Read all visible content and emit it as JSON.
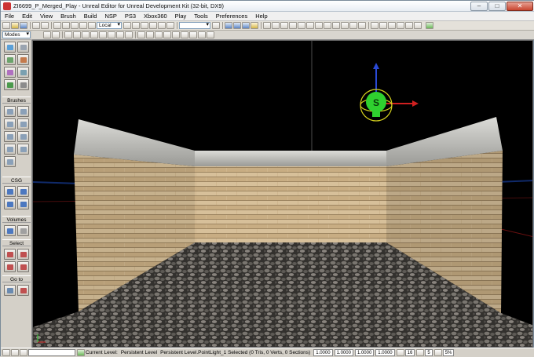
{
  "window": {
    "title": "ZI6699_P_Merged_Play - Unreal Editor for Unreal Development Kit (32-bit, DX9)",
    "min_label": "–",
    "max_label": "□",
    "close_label": "✕"
  },
  "menu": [
    {
      "label": "File"
    },
    {
      "label": "Edit"
    },
    {
      "label": "View"
    },
    {
      "label": "Brush"
    },
    {
      "label": "Build"
    },
    {
      "label": "NSP"
    },
    {
      "label": "PS3"
    },
    {
      "label": "Xbox360"
    },
    {
      "label": "Play"
    },
    {
      "label": "Tools"
    },
    {
      "label": "Preferences"
    },
    {
      "label": "Help"
    }
  ],
  "toolbar": {
    "coord_system": "Local"
  },
  "mode_selector": {
    "label": "Modes"
  },
  "sidebar": {
    "sections": [
      {
        "label": "Brushes"
      },
      {
        "label": "CSG"
      },
      {
        "label": "Volumes"
      },
      {
        "label": "Select"
      },
      {
        "label": "Go to"
      }
    ]
  },
  "viewport": {
    "gizmo_icon": "light-gizmo-icon",
    "gizmo_label": "S"
  },
  "statusbar": {
    "current_level_label": "Current Level:",
    "current_level_value": "Persistent Level",
    "selection_text": "Persistent Level.PointLight_1 Selected (0 Tris, 0 Verts, 0 Sections)",
    "scale_x": "1.0000",
    "scale_y": "1.0000",
    "scale_z": "1.0000",
    "scale_w": "1.0000",
    "grid_size": "16",
    "rot_snap": "5",
    "scale_snap": "5%"
  },
  "colors": {
    "titlebar": "#e8edf3",
    "viewport_bg": "#000000",
    "gizmo_green": "#2fd02f",
    "floor": "#5a5652",
    "brick": "#c9b18a",
    "concrete": "#b8b8b4"
  }
}
